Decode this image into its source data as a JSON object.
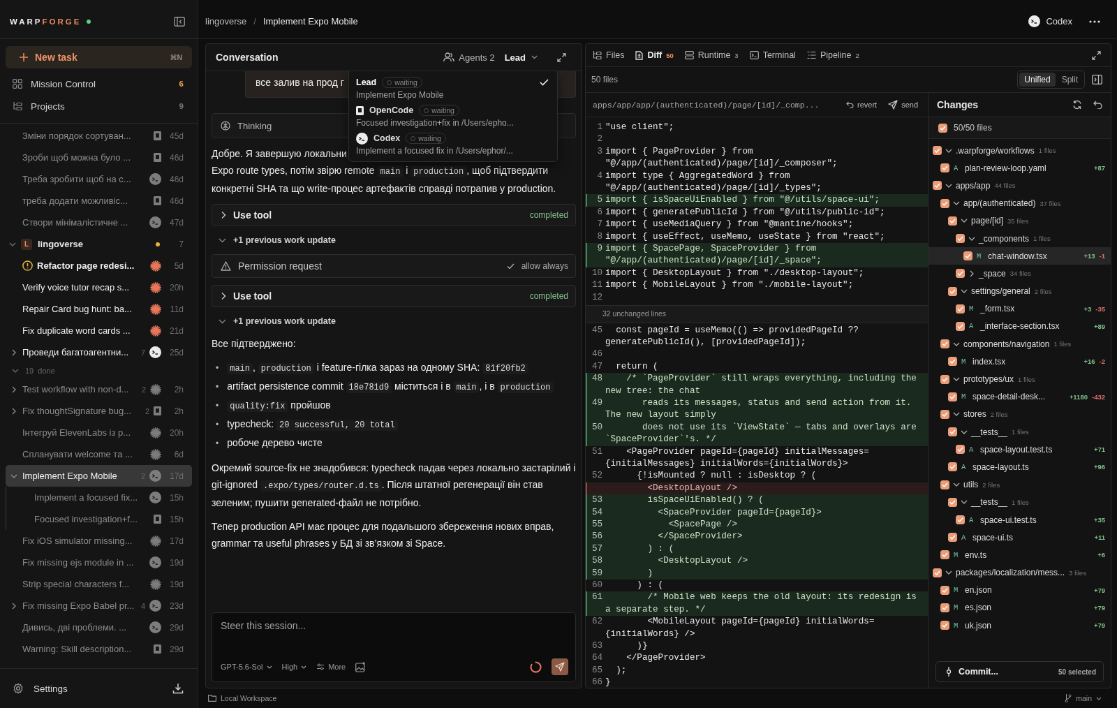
{
  "top_bar": {
    "breadcrumb": [
      "lingoverse",
      "Implement Expo Mobile"
    ],
    "separator": "/",
    "agent": "Codex"
  },
  "sidebar": {
    "brand": {
      "lead": "WARP",
      "accent": "FORGE",
      "online": true
    },
    "new_task": {
      "label": "New task",
      "shortcut": "⌘N"
    },
    "nav": [
      {
        "label": "Mission Control",
        "count": "6",
        "alert": true
      },
      {
        "label": "Projects",
        "count": "9",
        "alert": false
      }
    ],
    "tasks": [
      {
        "title": "Зміни порядок сортуван...",
        "kind": "opencode",
        "time": "45d",
        "selected": false
      },
      {
        "title": "Зроби щоб можна було ...",
        "kind": "opencode",
        "time": "46d",
        "selected": false
      },
      {
        "title": "Треба зробити щоб на с...",
        "kind": "codex",
        "time": "46d",
        "selected": false
      },
      {
        "title": "треба додати можливіс...",
        "kind": "opencode",
        "time": "46d",
        "selected": false
      },
      {
        "title": "Створи мінімалістичне ...",
        "kind": "codex",
        "time": "47d",
        "selected": false
      }
    ],
    "project": {
      "initial": "L",
      "name": "lingoverse",
      "expanded": true,
      "unread": true,
      "count": "7",
      "tasks": [
        {
          "title": "Refactor page redesi...",
          "kind": "claude",
          "time": "5d",
          "attention": true,
          "selected": false
        },
        {
          "title": "Verify voice tutor recap s...",
          "kind": "claude",
          "time": "20h",
          "attention": false,
          "selected": false
        },
        {
          "title": "Repair Card bug hunt: ba...",
          "kind": "claude",
          "time": "11d",
          "attention": false,
          "selected": false
        },
        {
          "title": "Fix duplicate word cards ...",
          "kind": "claude",
          "time": "21d",
          "attention": false,
          "selected": false
        },
        {
          "title": "Проведи багатоагентни...",
          "kind": "codex",
          "time": "25d",
          "count": "7",
          "expanded": false,
          "attention": false,
          "selected": false
        }
      ],
      "done": {
        "count": "19",
        "label": "done",
        "expanded": true,
        "tasks": [
          {
            "title": "Test workflow with non-d...",
            "kind": "claude",
            "time": "2h",
            "count": "2",
            "expanded": false,
            "selected": false
          },
          {
            "title": "Fix thoughtSignature bug...",
            "kind": "opencode",
            "time": "2h",
            "count": "2",
            "expanded": false,
            "selected": false
          },
          {
            "title": "Інтегруй ElevenLabs із р...",
            "kind": "claude",
            "time": "20h",
            "selected": false
          },
          {
            "title": "Спланувати welcome та ...",
            "kind": "claude",
            "time": "6d",
            "selected": false
          },
          {
            "title": "Implement Expo Mobile",
            "kind": "codex",
            "time": "17d",
            "count": "2",
            "expanded": true,
            "selected": true,
            "children": [
              {
                "title": "Implement a focused fix...",
                "kind": "codex",
                "time": "15h",
                "selected": false
              },
              {
                "title": "Focused investigation+f...",
                "kind": "opencode",
                "time": "15h",
                "selected": false
              }
            ]
          },
          {
            "title": "Fix iOS simulator missing...",
            "kind": "claude",
            "time": "17d",
            "selected": false
          },
          {
            "title": "Fix missing ejs module in ...",
            "kind": "codex",
            "time": "19d",
            "selected": false
          },
          {
            "title": "Strip special characters f...",
            "kind": "claude",
            "time": "19d",
            "selected": false
          },
          {
            "title": "Fix missing Expo Babel pr...",
            "kind": "codex",
            "time": "23d",
            "count": "4",
            "expanded": false,
            "selected": false
          },
          {
            "title": "Дивись, дві проблеми. ...",
            "kind": "codex",
            "time": "29d",
            "selected": false
          },
          {
            "title": "Warning: Skill description...",
            "kind": "opencode",
            "time": "29d",
            "selected": false
          }
        ]
      }
    },
    "settings": "Settings"
  },
  "conversation": {
    "title": "Conversation",
    "agents": "Agents 2",
    "lead": "Lead",
    "agent_menu": {
      "items": [
        {
          "name": "Lead",
          "kind": "lead",
          "status": "waiting",
          "subtitle": "Implement Expo Mobile",
          "selected": true
        },
        {
          "name": "OpenCode",
          "kind": "opencode",
          "status": "waiting",
          "subtitle": "Focused investigation+fix in /Users/epho...",
          "selected": false
        },
        {
          "name": "Codex",
          "kind": "codex",
          "status": "waiting",
          "subtitle": "Implement a focused fix in /Users/ephor/...",
          "selected": false
        }
      ]
    },
    "messages": [
      {
        "kind": "user",
        "text": "все залив на прод г"
      },
      {
        "kind": "thinking",
        "label": "Thinking"
      },
      {
        "kind": "paragraph",
        "segments": [
          {
            "kind": "text",
            "text": "Добре. Я завершую локальни"
          },
          {
            "kind": "break"
          },
          {
            "kind": "text",
            "text": "Expo route types, потім звірю remote "
          },
          {
            "kind": "code",
            "text": "main"
          },
          {
            "kind": "text",
            "text": " і "
          },
          {
            "kind": "code",
            "text": "production"
          },
          {
            "kind": "text",
            "text": ", щоб підтвердити конкретні SHA та що write-процес артефактів справді потрапив у production."
          }
        ]
      },
      {
        "kind": "tool",
        "label": "Use tool",
        "status": "completed"
      },
      {
        "kind": "update",
        "label": "+1 previous work update"
      },
      {
        "kind": "permission",
        "label": "Permission request",
        "status": "allow always"
      },
      {
        "kind": "tool",
        "label": "Use tool",
        "status": "completed"
      },
      {
        "kind": "update",
        "label": "+1 previous work update"
      },
      {
        "kind": "paragraph",
        "segments": [
          {
            "kind": "text",
            "text": "Все підтверджено:"
          }
        ]
      },
      {
        "kind": "list",
        "marker": "•",
        "items": [
          [
            {
              "kind": "code",
              "text": "main"
            },
            {
              "kind": "text",
              "text": ", "
            },
            {
              "kind": "code",
              "text": "production"
            },
            {
              "kind": "text",
              "text": " і feature-гілка зараз на одному SHA: "
            },
            {
              "kind": "code",
              "text": "81f20fb2"
            }
          ],
          [
            {
              "kind": "text",
              "text": "artifact persistence commit "
            },
            {
              "kind": "code",
              "text": "18e781d9"
            },
            {
              "kind": "text",
              "text": " міститься і в "
            },
            {
              "kind": "code",
              "text": "main"
            },
            {
              "kind": "text",
              "text": ", і в "
            },
            {
              "kind": "code",
              "text": "production"
            }
          ],
          [
            {
              "kind": "code",
              "text": "quality:fix"
            },
            {
              "kind": "text",
              "text": " пройшов"
            }
          ],
          [
            {
              "kind": "text",
              "text": "typecheck: "
            },
            {
              "kind": "code",
              "text": "20 successful, 20 total"
            }
          ],
          [
            {
              "kind": "text",
              "text": "робоче дерево чисте"
            }
          ]
        ]
      },
      {
        "kind": "paragraph",
        "segments": [
          {
            "kind": "text",
            "text": "Окремий source-fix не знадобився: typecheck падав через локально застарілий і git-ignored "
          },
          {
            "kind": "code",
            "text": ".expo/types/router.d.ts"
          },
          {
            "kind": "text",
            "text": ". Після штатної регенерації він став зеленим; пушити generated-файл не потрібно."
          }
        ]
      },
      {
        "kind": "paragraph",
        "segments": [
          {
            "kind": "text",
            "text": "Тепер production API має процес для подальшого збереження нових вправ, grammar та useful phrases у БД зі зв’язком зі Space."
          }
        ]
      }
    ],
    "composer": {
      "placeholder": "Steer this session...",
      "model": "GPT-5.6-Sol",
      "effort": "High",
      "more": "More"
    }
  },
  "review": {
    "tabs": [
      {
        "label": "Files",
        "selected": false
      },
      {
        "label": "Diff",
        "count": "50",
        "selected": true
      },
      {
        "label": "Runtime",
        "count": "3",
        "selected": false
      },
      {
        "label": "Terminal",
        "selected": false
      },
      {
        "label": "Pipeline",
        "count": "2",
        "selected": false
      }
    ],
    "file_count": "50 files",
    "view_modes": [
      {
        "label": "Unified",
        "selected": true
      },
      {
        "label": "Split",
        "selected": false
      }
    ],
    "diff": {
      "path": "apps/app/app/(authenticated)/page/[id]/_comp...",
      "revert": "revert",
      "send": "send",
      "lines": [
        {
          "num": "1",
          "kind": "context",
          "text": "\"use client\";"
        },
        {
          "num": "2",
          "kind": "context"
        },
        {
          "num": "3",
          "kind": "context",
          "text": "import { PageProvider } from \"@/app/(authenticated)/page/[id]/_composer\";"
        },
        {
          "num": "4",
          "kind": "context",
          "text": "import type { AggregatedWord } from \"@/app/(authenticated)/page/[id]/_types\";"
        },
        {
          "num": "5",
          "kind": "added",
          "text": "import { isSpaceUiEnabled } from \"@/utils/space-ui\";"
        },
        {
          "num": "6",
          "kind": "context",
          "text": "import { generatePublicId } from \"@/utils/public-id\";"
        },
        {
          "num": "7",
          "kind": "context",
          "text": "import { useMediaQuery } from \"@mantine/hooks\";"
        },
        {
          "num": "8",
          "kind": "context",
          "text": "import { useEffect, useMemo, useState } from \"react\";"
        },
        {
          "num": "9",
          "kind": "added",
          "text": "import { SpacePage, SpaceProvider } from \"@/app/(authenticated)/page/[id]/_space\";"
        },
        {
          "num": "10",
          "kind": "context",
          "text": "import { DesktopLayout } from \"./desktop-layout\";"
        },
        {
          "num": "11",
          "kind": "context",
          "text": "import { MobileLayout } from \"./mobile-layout\";"
        },
        {
          "num": "12",
          "kind": "context"
        },
        {
          "kind": "fold",
          "text": "32 unchanged lines"
        },
        {
          "num": "45",
          "kind": "context",
          "text": "  const pageId = useMemo(() => providedPageId ?? generatePublicId(), [providedPageId]);"
        },
        {
          "num": "46",
          "kind": "context"
        },
        {
          "num": "47",
          "kind": "context",
          "text": "  return ("
        },
        {
          "num": "48",
          "kind": "added",
          "text": "    /* `PageProvider` still wraps everything, including the new tree: the chat"
        },
        {
          "num": "49",
          "kind": "added",
          "text": "       reads its messages, status and send action from it. The new layout simply"
        },
        {
          "num": "50",
          "kind": "added",
          "text": "       does not use its `ViewState` — tabs and overlays are `SpaceProvider`'s. */"
        },
        {
          "num": "51",
          "kind": "context",
          "text": "    <PageProvider pageId={pageId} initialMessages={initialMessages} initialWords={initialWords}>"
        },
        {
          "num": "52",
          "kind": "context",
          "text": "      {!isMounted ? null : isDesktop ? ("
        },
        {
          "kind": "removed",
          "text": "        <DesktopLayout />"
        },
        {
          "num": "53",
          "kind": "added",
          "text": "        isSpaceUiEnabled() ? ("
        },
        {
          "num": "54",
          "kind": "added",
          "text": "          <SpaceProvider pageId={pageId}>"
        },
        {
          "num": "55",
          "kind": "added",
          "text": "            <SpacePage />"
        },
        {
          "num": "56",
          "kind": "added",
          "text": "          </SpaceProvider>"
        },
        {
          "num": "57",
          "kind": "added",
          "text": "        ) : ("
        },
        {
          "num": "58",
          "kind": "added",
          "text": "          <DesktopLayout />"
        },
        {
          "num": "59",
          "kind": "added",
          "text": "        )"
        },
        {
          "num": "60",
          "kind": "context",
          "text": "      ) : ("
        },
        {
          "num": "61",
          "kind": "added",
          "text": "        /* Mobile web keeps the old layout: its redesign is a separate step. */"
        },
        {
          "num": "62",
          "kind": "context",
          "text": "        <MobileLayout pageId={pageId} initialWords={initialWords} />"
        },
        {
          "num": "63",
          "kind": "context",
          "text": "      )}"
        },
        {
          "num": "64",
          "kind": "context",
          "text": "    </PageProvider>"
        },
        {
          "num": "65",
          "kind": "context",
          "text": "  );"
        },
        {
          "num": "66",
          "kind": "context",
          "text": "}"
        }
      ]
    },
    "changes": {
      "title": "Changes",
      "all": {
        "label": "50/50 files",
        "checked": true
      },
      "tree": [
        {
          "kind": "folder",
          "name": ".warpforge/workflows",
          "count": "1 files",
          "checked": true,
          "expanded": true,
          "children": [
            {
              "kind": "file",
              "status": "A",
              "name": "plan-review-loop.yaml",
              "added": "+87",
              "checked": true,
              "selected": false
            }
          ]
        },
        {
          "kind": "folder",
          "name": "apps/app",
          "count": "44 files",
          "checked": true,
          "expanded": true,
          "children": [
            {
              "kind": "folder",
              "name": "app/(authenticated)",
              "count": "37 files",
              "checked": true,
              "expanded": true,
              "children": [
                {
                  "kind": "folder",
                  "name": "page/[id]",
                  "count": "35 files",
                  "checked": true,
                  "expanded": true,
                  "children": [
                    {
                      "kind": "folder",
                      "name": "_components",
                      "count": "1 files",
                      "checked": true,
                      "expanded": true,
                      "children": [
                        {
                          "kind": "file",
                          "status": "M",
                          "name": "chat-window.tsx",
                          "added": "+13",
                          "removed": "-1",
                          "checked": true,
                          "selected": true
                        }
                      ]
                    },
                    {
                      "kind": "folder",
                      "name": "_space",
                      "count": "34 files",
                      "checked": true,
                      "expanded": false
                    }
                  ]
                },
                {
                  "kind": "folder",
                  "name": "settings/general",
                  "count": "2 files",
                  "checked": true,
                  "expanded": true,
                  "children": [
                    {
                      "kind": "file",
                      "status": "M",
                      "name": "_form.tsx",
                      "added": "+3",
                      "removed": "-35",
                      "checked": true,
                      "selected": false
                    },
                    {
                      "kind": "file",
                      "status": "A",
                      "name": "_interface-section.tsx",
                      "added": "+89",
                      "checked": true,
                      "selected": false
                    }
                  ]
                }
              ]
            },
            {
              "kind": "folder",
              "name": "components/navigation",
              "count": "1 files",
              "checked": true,
              "expanded": true,
              "children": [
                {
                  "kind": "file",
                  "status": "M",
                  "name": "index.tsx",
                  "added": "+16",
                  "removed": "-2",
                  "checked": true,
                  "selected": false
                }
              ]
            },
            {
              "kind": "folder",
              "name": "prototypes/ux",
              "count": "1 files",
              "checked": true,
              "expanded": true,
              "children": [
                {
                  "kind": "file",
                  "status": "M",
                  "name": "space-detail-desk...",
                  "added": "+1180",
                  "removed": "-432",
                  "checked": true,
                  "selected": false
                }
              ]
            },
            {
              "kind": "folder",
              "name": "stores",
              "count": "2 files",
              "checked": true,
              "expanded": true,
              "children": [
                {
                  "kind": "folder",
                  "name": "__tests__",
                  "count": "1 files",
                  "checked": true,
                  "expanded": true,
                  "children": [
                    {
                      "kind": "file",
                      "status": "A",
                      "name": "space-layout.test.ts",
                      "added": "+71",
                      "checked": true,
                      "selected": false
                    }
                  ]
                },
                {
                  "kind": "file",
                  "status": "A",
                  "name": "space-layout.ts",
                  "added": "+96",
                  "checked": true,
                  "selected": false
                }
              ]
            },
            {
              "kind": "folder",
              "name": "utils",
              "count": "2 files",
              "checked": true,
              "expanded": true,
              "children": [
                {
                  "kind": "folder",
                  "name": "__tests__",
                  "count": "1 files",
                  "checked": true,
                  "expanded": true,
                  "children": [
                    {
                      "kind": "file",
                      "status": "A",
                      "name": "space-ui.test.ts",
                      "added": "+35",
                      "checked": true,
                      "selected": false
                    }
                  ]
                },
                {
                  "kind": "file",
                  "status": "A",
                  "name": "space-ui.ts",
                  "added": "+11",
                  "checked": true,
                  "selected": false
                }
              ]
            },
            {
              "kind": "file",
              "status": "M",
              "name": "env.ts",
              "added": "+6",
              "checked": true,
              "selected": false
            }
          ]
        },
        {
          "kind": "folder",
          "name": "packages/localization/mess...",
          "count": "3 files",
          "checked": true,
          "expanded": true,
          "children": [
            {
              "kind": "file",
              "status": "M",
              "name": "en.json",
              "added": "+79",
              "checked": true,
              "selected": false
            },
            {
              "kind": "file",
              "status": "M",
              "name": "es.json",
              "added": "+79",
              "checked": true,
              "selected": false
            },
            {
              "kind": "file",
              "status": "M",
              "name": "uk.json",
              "added": "+79",
              "checked": true,
              "selected": false
            }
          ]
        }
      ],
      "commit": {
        "label": "Commit...",
        "selected": "50 selected"
      }
    }
  },
  "status_bar": {
    "workspace": "Local Workspace",
    "branch": "main"
  }
}
